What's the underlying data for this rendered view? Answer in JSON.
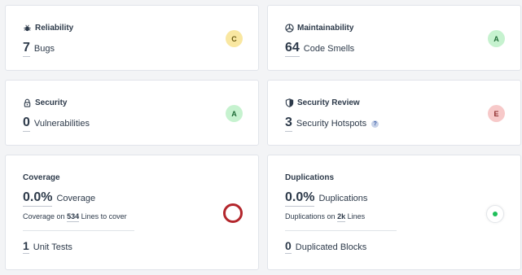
{
  "reliability": {
    "title": "Reliability",
    "icon": "bug-icon",
    "value": "7",
    "unit": "Bugs",
    "rating": "C"
  },
  "maintainability": {
    "title": "Maintainability",
    "icon": "maintainability-icon",
    "value": "64",
    "unit": "Code Smells",
    "rating": "A"
  },
  "security": {
    "title": "Security",
    "icon": "lock-icon",
    "value": "0",
    "unit": "Vulnerabilities",
    "rating": "A"
  },
  "security_review": {
    "title": "Security Review",
    "icon": "shield-icon",
    "value": "3",
    "unit": "Security Hotspots",
    "help": "?",
    "rating": "E"
  },
  "coverage": {
    "title": "Coverage",
    "value": "0.0%",
    "unit": "Coverage",
    "lines_prefix": "Coverage on",
    "lines_value": "534",
    "lines_suffix": "Lines to cover",
    "tests_value": "1",
    "tests_unit": "Unit Tests",
    "status_color": "#b3262c"
  },
  "duplications": {
    "title": "Duplications",
    "value": "0.0%",
    "unit": "Duplications",
    "lines_prefix": "Duplications on",
    "lines_value": "2k",
    "lines_suffix": "Lines",
    "blocks_value": "0",
    "blocks_unit": "Duplicated Blocks",
    "status_color": "#1fbf5a"
  }
}
